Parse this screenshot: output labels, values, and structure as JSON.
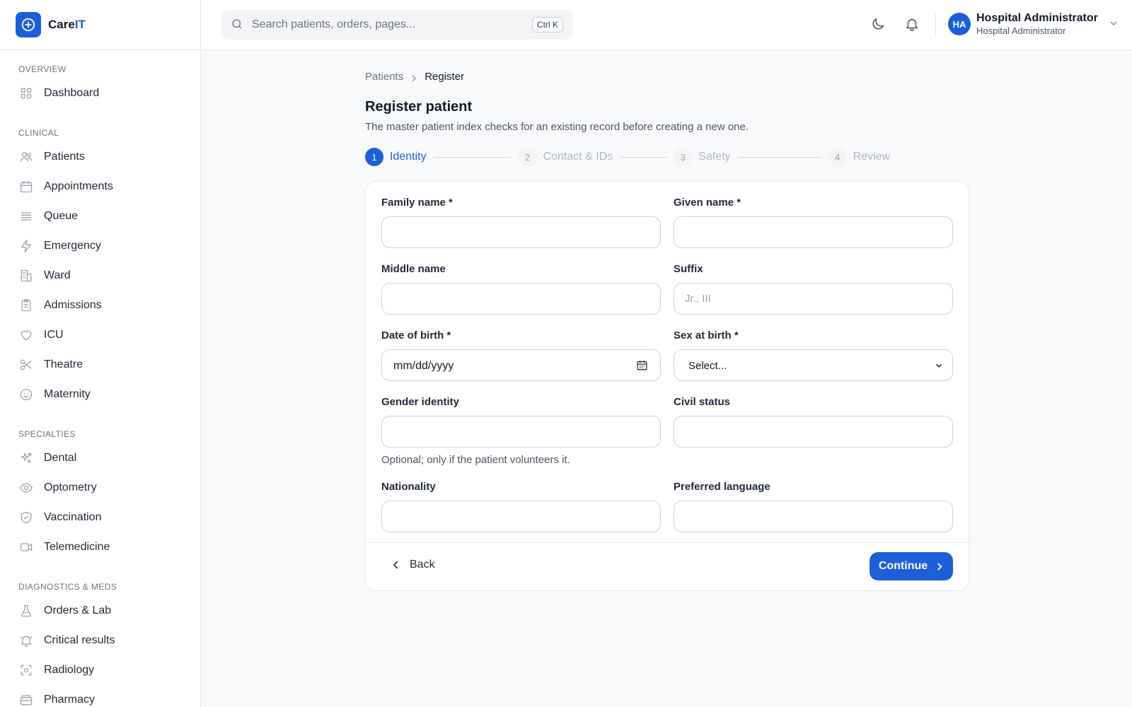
{
  "brand": {
    "name_prefix": "Care",
    "name_suffix": "IT"
  },
  "search": {
    "placeholder": "Search patients, orders, pages...",
    "shortcut": "Ctrl K"
  },
  "user": {
    "initials": "HA",
    "name": "Hospital Administrator",
    "role": "Hospital Administrator"
  },
  "sidebar": {
    "sections": [
      {
        "title": "OVERVIEW",
        "items": [
          {
            "label": "Dashboard",
            "icon": "grid-icon"
          }
        ]
      },
      {
        "title": "CLINICAL",
        "items": [
          {
            "label": "Patients",
            "icon": "users-icon"
          },
          {
            "label": "Appointments",
            "icon": "calendar-icon"
          },
          {
            "label": "Queue",
            "icon": "list-icon"
          },
          {
            "label": "Emergency",
            "icon": "bolt-icon"
          },
          {
            "label": "Ward",
            "icon": "building-icon"
          },
          {
            "label": "Admissions",
            "icon": "clipboard-icon"
          },
          {
            "label": "ICU",
            "icon": "heart-icon"
          },
          {
            "label": "Theatre",
            "icon": "scissors-icon"
          },
          {
            "label": "Maternity",
            "icon": "smile-icon"
          }
        ]
      },
      {
        "title": "SPECIALTIES",
        "items": [
          {
            "label": "Dental",
            "icon": "sparkles-icon"
          },
          {
            "label": "Optometry",
            "icon": "eye-icon"
          },
          {
            "label": "Vaccination",
            "icon": "shield-check-icon"
          },
          {
            "label": "Telemedicine",
            "icon": "video-icon"
          }
        ]
      },
      {
        "title": "DIAGNOSTICS & MEDS",
        "items": [
          {
            "label": "Orders & Lab",
            "icon": "flask-icon"
          },
          {
            "label": "Critical results",
            "icon": "bell-alert-icon"
          },
          {
            "label": "Radiology",
            "icon": "scan-icon"
          },
          {
            "label": "Pharmacy",
            "icon": "pill-box-icon"
          }
        ]
      }
    ]
  },
  "breadcrumb": {
    "parent": "Patients",
    "current": "Register"
  },
  "page": {
    "title": "Register patient",
    "subtitle": "The master patient index checks for an existing record before creating a new one."
  },
  "stepper": {
    "steps": [
      {
        "num": "1",
        "label": "Identity",
        "active": true
      },
      {
        "num": "2",
        "label": "Contact & IDs",
        "active": false
      },
      {
        "num": "3",
        "label": "Safety",
        "active": false
      },
      {
        "num": "4",
        "label": "Review",
        "active": false
      }
    ]
  },
  "form": {
    "family_name": {
      "label": "Family name *",
      "value": "",
      "placeholder": ""
    },
    "given_name": {
      "label": "Given name *",
      "value": "",
      "placeholder": ""
    },
    "middle_name": {
      "label": "Middle name",
      "value": "",
      "placeholder": ""
    },
    "suffix": {
      "label": "Suffix",
      "value": "",
      "placeholder": "Jr., III"
    },
    "dob": {
      "label": "Date of birth *",
      "value": "mm/dd/yyyy"
    },
    "sex": {
      "label": "Sex at birth *",
      "value": "Select..."
    },
    "gender_identity": {
      "label": "Gender identity",
      "value": "",
      "hint": "Optional; only if the patient volunteers it."
    },
    "civil_status": {
      "label": "Civil status",
      "value": ""
    },
    "nationality": {
      "label": "Nationality",
      "value": ""
    },
    "preferred_language": {
      "label": "Preferred language",
      "value": ""
    }
  },
  "footer": {
    "back_label": "Back",
    "continue_label": "Continue"
  },
  "colors": {
    "accent": "#1d5fd6",
    "background": "#f8f9fb"
  }
}
